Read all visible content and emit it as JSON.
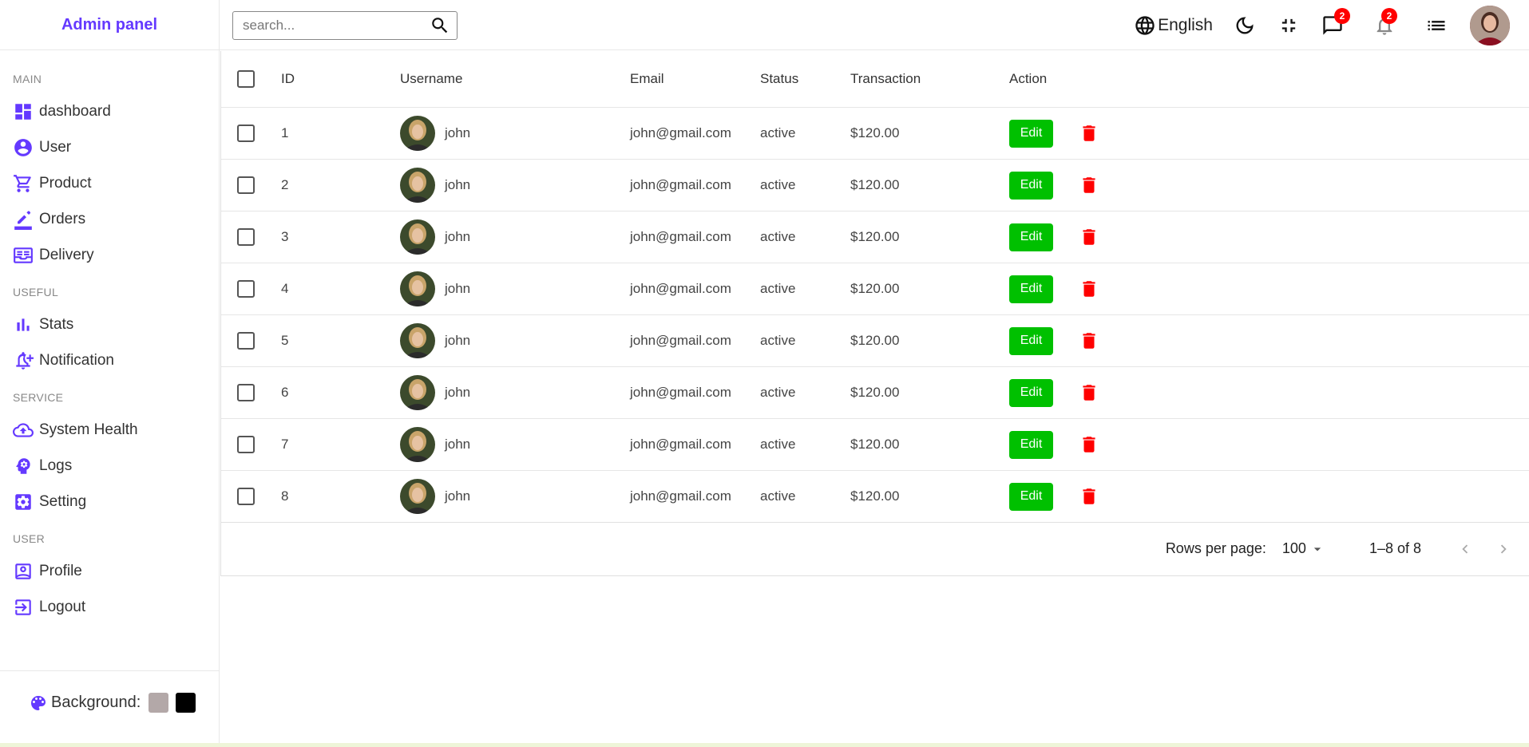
{
  "sidebar": {
    "logo": "Admin panel",
    "sections": [
      {
        "title": "MAIN",
        "items": [
          {
            "label": "dashboard",
            "icon": "dashboard-icon"
          },
          {
            "label": "User",
            "icon": "user-icon"
          },
          {
            "label": "Product",
            "icon": "cart-icon"
          },
          {
            "label": "Orders",
            "icon": "pen-icon"
          },
          {
            "label": "Delivery",
            "icon": "delivery-icon"
          }
        ]
      },
      {
        "title": "USEFUL",
        "items": [
          {
            "label": "Stats",
            "icon": "bar-chart-icon"
          },
          {
            "label": "Notification",
            "icon": "notification-add-icon"
          }
        ]
      },
      {
        "title": "SERVICE",
        "items": [
          {
            "label": "System Health",
            "icon": "cloud-upload-icon"
          },
          {
            "label": "Logs",
            "icon": "psychology-icon"
          },
          {
            "label": "Setting",
            "icon": "settings-icon"
          }
        ]
      },
      {
        "title": "USER",
        "items": [
          {
            "label": "Profile",
            "icon": "profile-icon"
          },
          {
            "label": "Logout",
            "icon": "logout-icon"
          }
        ]
      }
    ],
    "background_label": "Background:",
    "swatches": [
      "#b3a8a8",
      "#000000"
    ]
  },
  "navbar": {
    "search_placeholder": "search...",
    "language": "English",
    "chat_badge": "2",
    "notification_badge": "2"
  },
  "table": {
    "headers": {
      "id": "ID",
      "username": "Username",
      "email": "Email",
      "status": "Status",
      "transaction": "Transaction",
      "action": "Action"
    },
    "rows": [
      {
        "id": "1",
        "username": "john",
        "email": "john@gmail.com",
        "status": "active",
        "transaction": "$120.00"
      },
      {
        "id": "2",
        "username": "john",
        "email": "john@gmail.com",
        "status": "active",
        "transaction": "$120.00"
      },
      {
        "id": "3",
        "username": "john",
        "email": "john@gmail.com",
        "status": "active",
        "transaction": "$120.00"
      },
      {
        "id": "4",
        "username": "john",
        "email": "john@gmail.com",
        "status": "active",
        "transaction": "$120.00"
      },
      {
        "id": "5",
        "username": "john",
        "email": "john@gmail.com",
        "status": "active",
        "transaction": "$120.00"
      },
      {
        "id": "6",
        "username": "john",
        "email": "john@gmail.com",
        "status": "active",
        "transaction": "$120.00"
      },
      {
        "id": "7",
        "username": "john",
        "email": "john@gmail.com",
        "status": "active",
        "transaction": "$120.00"
      },
      {
        "id": "8",
        "username": "john",
        "email": "john@gmail.com",
        "status": "active",
        "transaction": "$120.00"
      }
    ],
    "edit_label": "Edit"
  },
  "pagination": {
    "rows_per_page_label": "Rows per page:",
    "rows_per_page": "100",
    "range": "1–8 of 8"
  },
  "colors": {
    "accent": "#6439ff",
    "edit": "#00c000",
    "delete": "#ff0000",
    "badge": "#ff0000"
  }
}
